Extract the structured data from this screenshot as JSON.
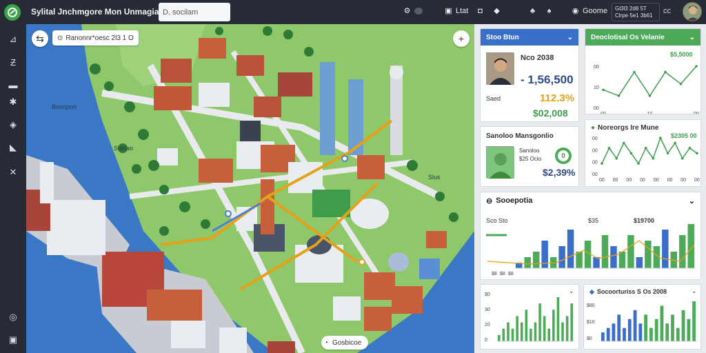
{
  "header": {
    "title": "Sylital Jnchmgore Mon Unmagia",
    "search_placeholder": "D. socilam",
    "items": [
      {
        "icon": "gear-icon",
        "label": ""
      },
      {
        "icon": "film-icon",
        "label": "Ltat"
      },
      {
        "icon": "folder-icon",
        "label": ""
      },
      {
        "icon": "tag-icon",
        "label": ""
      },
      {
        "icon": "users-icon",
        "label": ""
      },
      {
        "icon": "people-icon",
        "label": ""
      },
      {
        "icon": "globe-icon",
        "label": "Goome"
      }
    ],
    "status_lines": [
      "Gl3l3 2d8 5T",
      "Clrpe 5e1 3b61"
    ],
    "cc_label": "cc"
  },
  "map": {
    "location_label": "Ranonnr*oesc 2l3 1 O",
    "labels": [
      "Boonpon",
      "Solnao",
      "Slus"
    ],
    "bottom_label": "Gosbicoe"
  },
  "cards": {
    "profile": {
      "title": "Stoo Btun",
      "name": "Nco 2038",
      "value1": "- 1,56,500",
      "value2": "112.3%",
      "value3": "$02,008",
      "label": "Saed"
    },
    "trend_top": {
      "title": "Deoclotisal Os Velanie",
      "value": "$5,5000",
      "y_ticks": [
        "00",
        "10",
        "00"
      ],
      "x_ticks": [
        "00",
        "10",
        "00"
      ],
      "series": [
        3,
        2,
        6,
        2,
        6,
        4,
        7
      ]
    },
    "second_profile": {
      "title": "Sanoloo Mansgonlio",
      "lines": [
        "Sanoloo",
        "$25 Ocio"
      ],
      "big": "$2,39%",
      "ring": "0"
    },
    "trend_mid": {
      "title": "Noreorgs Ire Mune",
      "value": "$2305 00",
      "y_ticks": [
        "00",
        "00",
        "00",
        "00"
      ],
      "x_ticks": [
        "00",
        "00",
        "00",
        "00",
        "00",
        "00",
        "00",
        "00"
      ],
      "series": [
        2,
        5,
        3,
        6,
        4,
        2,
        5,
        3,
        7,
        4,
        6,
        3,
        5,
        4
      ]
    },
    "spending": {
      "title": "Sooepotia",
      "left_label": "Sco Sto",
      "mid_label": "$35",
      "right_label": "$19700",
      "legend": [
        "$8",
        "$8",
        "$8"
      ],
      "bars": [
        {
          "v": 1,
          "c": "#3a6fc9"
        },
        {
          "v": 2,
          "c": "#4caa58"
        },
        {
          "v": 3,
          "c": "#4caa58"
        },
        {
          "v": 5,
          "c": "#3a6fc9"
        },
        {
          "v": 2,
          "c": "#4caa58"
        },
        {
          "v": 4,
          "c": "#3a6fc9"
        },
        {
          "v": 7,
          "c": "#3a6fc9"
        },
        {
          "v": 3,
          "c": "#4caa58"
        },
        {
          "v": 5,
          "c": "#4caa58"
        },
        {
          "v": 2,
          "c": "#3a6fc9"
        },
        {
          "v": 6,
          "c": "#4caa58"
        },
        {
          "v": 4,
          "c": "#3a6fc9"
        },
        {
          "v": 3,
          "c": "#4caa58"
        },
        {
          "v": 6,
          "c": "#4caa58"
        },
        {
          "v": 2,
          "c": "#3a6fc9"
        },
        {
          "v": 5,
          "c": "#4caa58"
        },
        {
          "v": 4,
          "c": "#4caa58"
        },
        {
          "v": 7,
          "c": "#3a6fc9"
        },
        {
          "v": 3,
          "c": "#4caa58"
        },
        {
          "v": 6,
          "c": "#4caa58"
        },
        {
          "v": 8,
          "c": "#4caa58"
        }
      ]
    },
    "bars_left": {
      "y_ticks": [
        "$0",
        "30",
        "20",
        "0"
      ],
      "bars": [
        1,
        2,
        3,
        2,
        4,
        3,
        5,
        2,
        3,
        6,
        4,
        2,
        5,
        7,
        3,
        4,
        6
      ]
    },
    "bars_right": {
      "title": "Socoorturiss S Os 2008",
      "y_ticks": [
        "$80",
        "$10",
        "$0"
      ],
      "bars": [
        {
          "v": 2,
          "c": "#3a6fc9"
        },
        {
          "v": 3,
          "c": "#3a6fc9"
        },
        {
          "v": 4,
          "c": "#3a6fc9"
        },
        {
          "v": 6,
          "c": "#3a6fc9"
        },
        {
          "v": 3,
          "c": "#3a6fc9"
        },
        {
          "v": 5,
          "c": "#3a6fc9"
        },
        {
          "v": 7,
          "c": "#3a6fc9"
        },
        {
          "v": 4,
          "c": "#3a6fc9"
        },
        {
          "v": 6,
          "c": "#4caa58"
        },
        {
          "v": 3,
          "c": "#4caa58"
        },
        {
          "v": 5,
          "c": "#4caa58"
        },
        {
          "v": 8,
          "c": "#4caa58"
        },
        {
          "v": 4,
          "c": "#4caa58"
        },
        {
          "v": 6,
          "c": "#4caa58"
        },
        {
          "v": 3,
          "c": "#4caa58"
        },
        {
          "v": 7,
          "c": "#4caa58"
        },
        {
          "v": 5,
          "c": "#4caa58"
        },
        {
          "v": 9,
          "c": "#4caa58"
        }
      ]
    }
  },
  "colors": {
    "accent_green": "#4caa58",
    "accent_blue": "#3a6fc9",
    "warning": "#e3a21a",
    "bg": "#262b36"
  }
}
